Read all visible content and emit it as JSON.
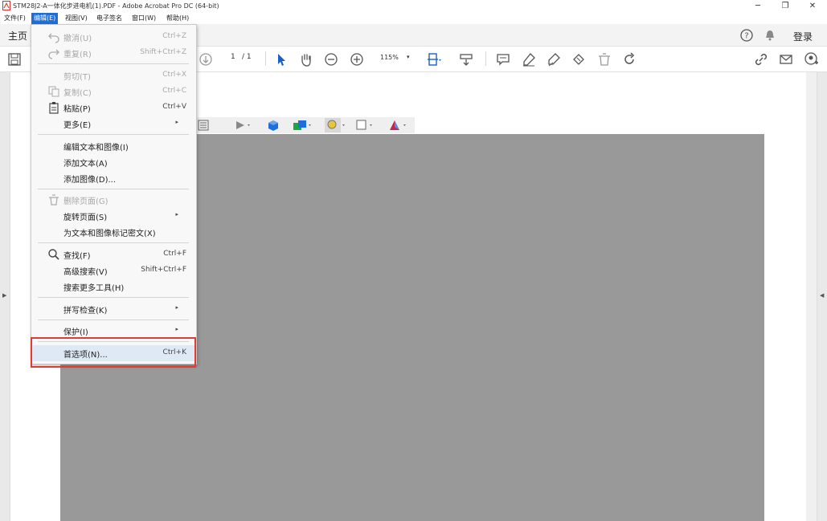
{
  "window": {
    "title": "STM28J2-A一体化步进电机(1).PDF - Adobe Acrobat Pro DC (64-bit)",
    "minimize": "─",
    "restore": "❐",
    "close": "✕"
  },
  "menubar": {
    "file": "文件(F)",
    "edit": "编辑(E)",
    "view": "视图(V)",
    "esign": "电子签名",
    "window": "窗口(W)",
    "help": "帮助(H)"
  },
  "tabs": {
    "home": "主页",
    "login": "登录"
  },
  "toolbar": {
    "page_current": "1",
    "page_total": "/ 1",
    "zoom": "115%"
  },
  "edit_menu": {
    "undo": {
      "label": "撤消(U)",
      "shortcut": "Ctrl+Z"
    },
    "redo": {
      "label": "重复(R)",
      "shortcut": "Shift+Ctrl+Z"
    },
    "cut": {
      "label": "剪切(T)",
      "shortcut": "Ctrl+X"
    },
    "copy": {
      "label": "复制(C)",
      "shortcut": "Ctrl+C"
    },
    "paste": {
      "label": "粘贴(P)",
      "shortcut": "Ctrl+V"
    },
    "more": {
      "label": "更多(E)"
    },
    "edit_text_image": {
      "label": "编辑文本和图像(I)"
    },
    "add_text": {
      "label": "添加文本(A)"
    },
    "add_image": {
      "label": "添加图像(D)..."
    },
    "delete_page": {
      "label": "删除页面(G)"
    },
    "rotate_page": {
      "label": "旋转页面(S)"
    },
    "redact": {
      "label": "为文本和图像标记密文(X)"
    },
    "find": {
      "label": "查找(F)",
      "shortcut": "Ctrl+F"
    },
    "advanced_search": {
      "label": "高级搜索(V)",
      "shortcut": "Shift+Ctrl+F"
    },
    "search_more_tools": {
      "label": "搜索更多工具(H)"
    },
    "spell_check": {
      "label": "拼写检查(K)"
    },
    "protect": {
      "label": "保护(I)"
    },
    "preferences": {
      "label": "首选项(N)...",
      "shortcut": "Ctrl+K"
    }
  },
  "colors": {
    "accent": "#1f6ed4",
    "highlight_box": "#e53935",
    "canvas_gray": "#999999"
  }
}
